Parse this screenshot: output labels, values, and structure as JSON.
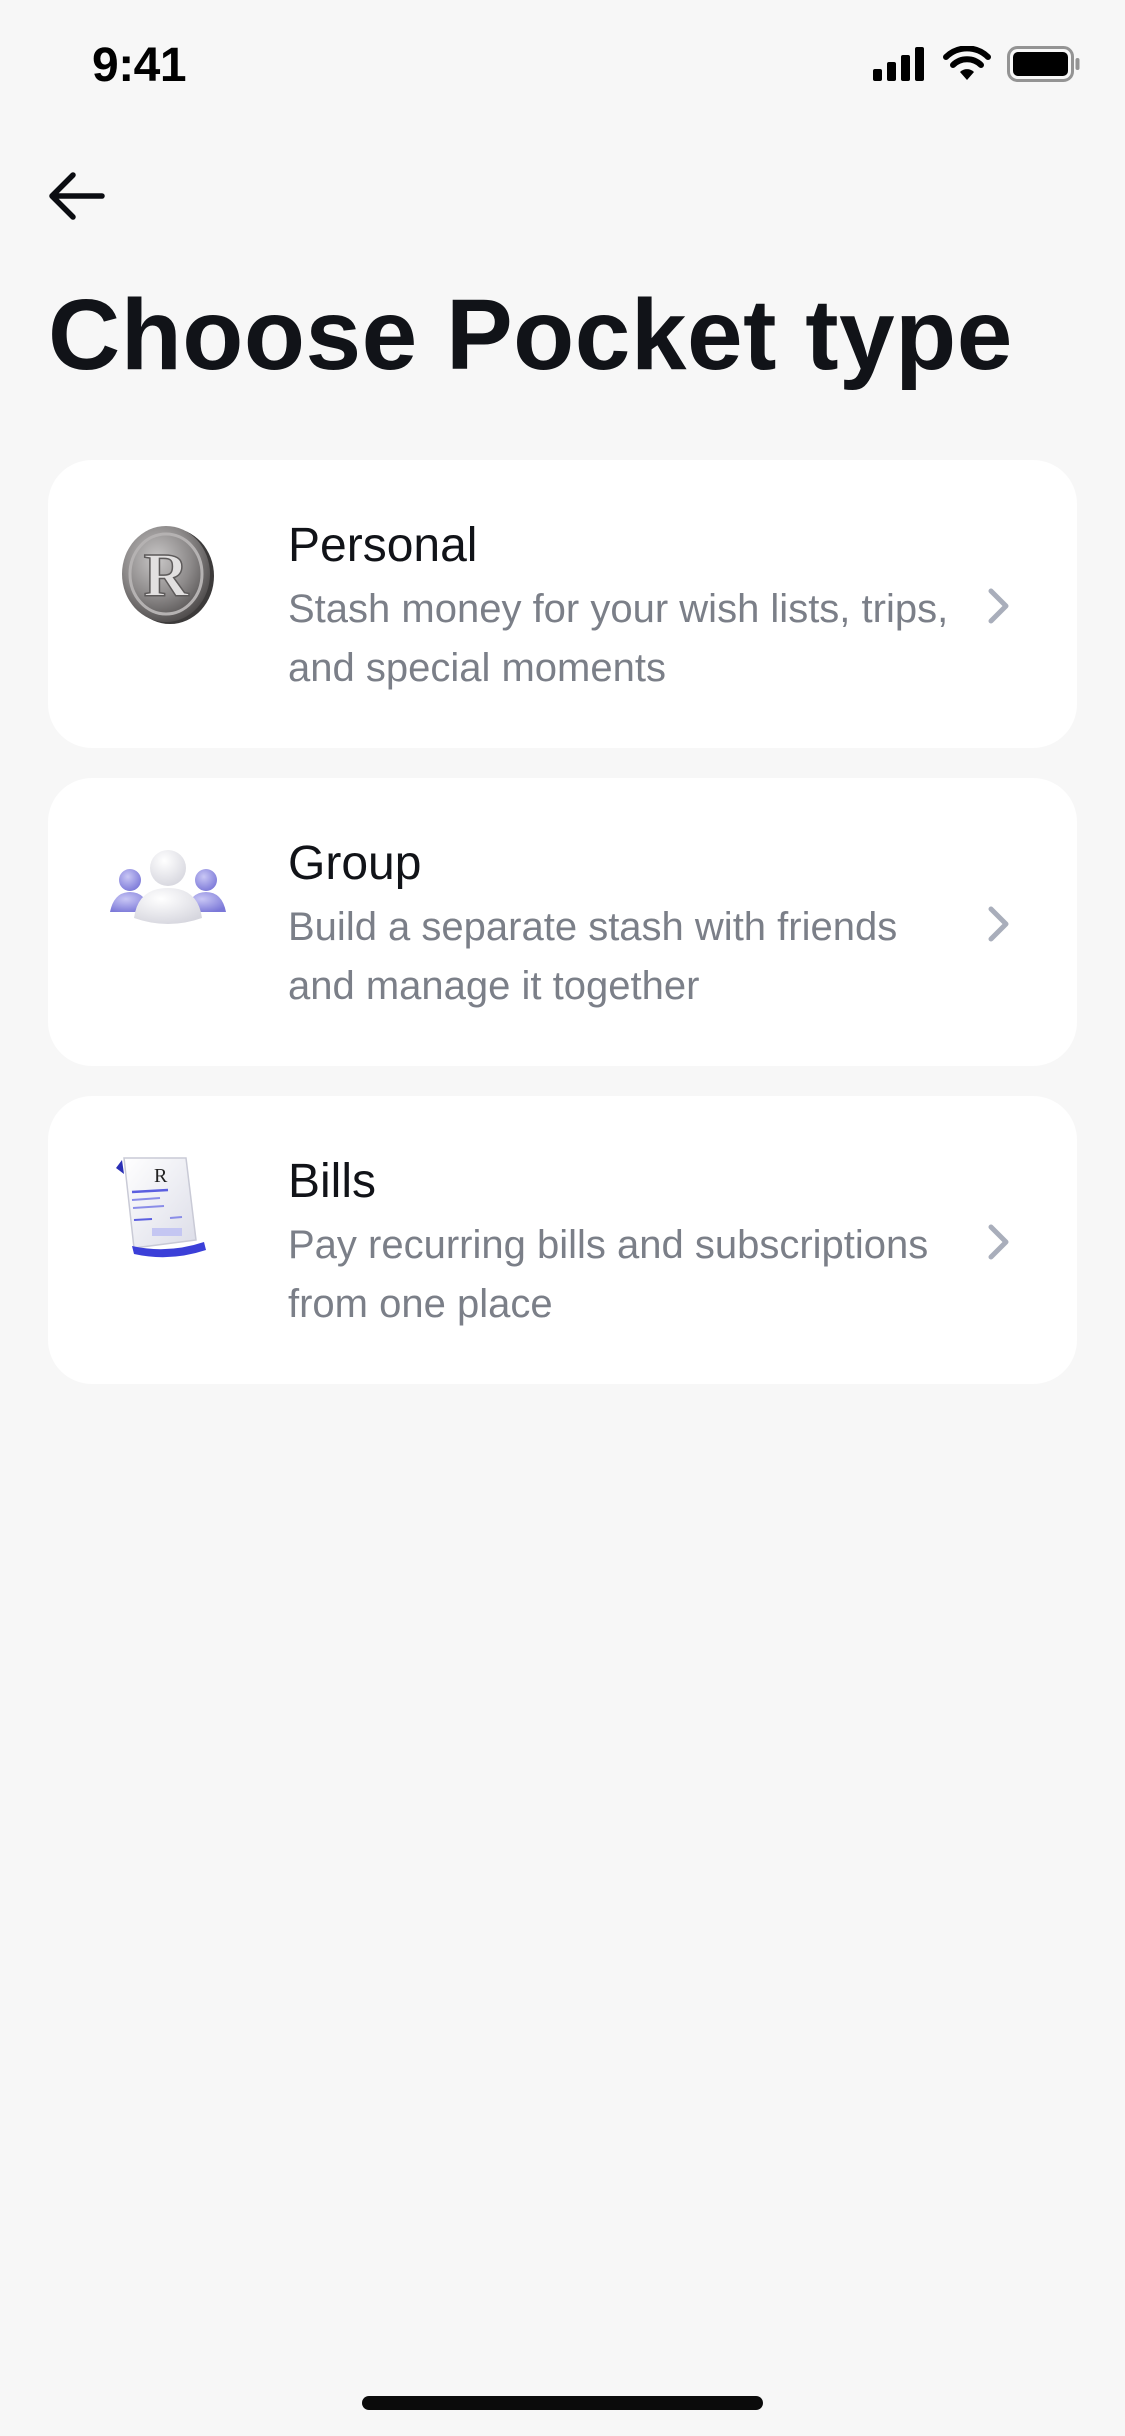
{
  "status_bar": {
    "time": "9:41"
  },
  "title": "Choose Pocket type",
  "options": [
    {
      "title": "Personal",
      "description": "Stash money for your wish lists, trips, and special moments",
      "icon": "revolut-coin-icon"
    },
    {
      "title": "Group",
      "description": "Build a separate stash with friends and manage it together",
      "icon": "group-people-icon"
    },
    {
      "title": "Bills",
      "description": "Pay recurring bills and subscriptions from one place",
      "icon": "bill-receipt-icon"
    }
  ],
  "colors": {
    "background": "#f7f7f7",
    "card": "#ffffff",
    "title_text": "#111318",
    "description_text": "#7b7f88",
    "chevron": "#a9aebb",
    "accent": "#3b3fd8"
  }
}
